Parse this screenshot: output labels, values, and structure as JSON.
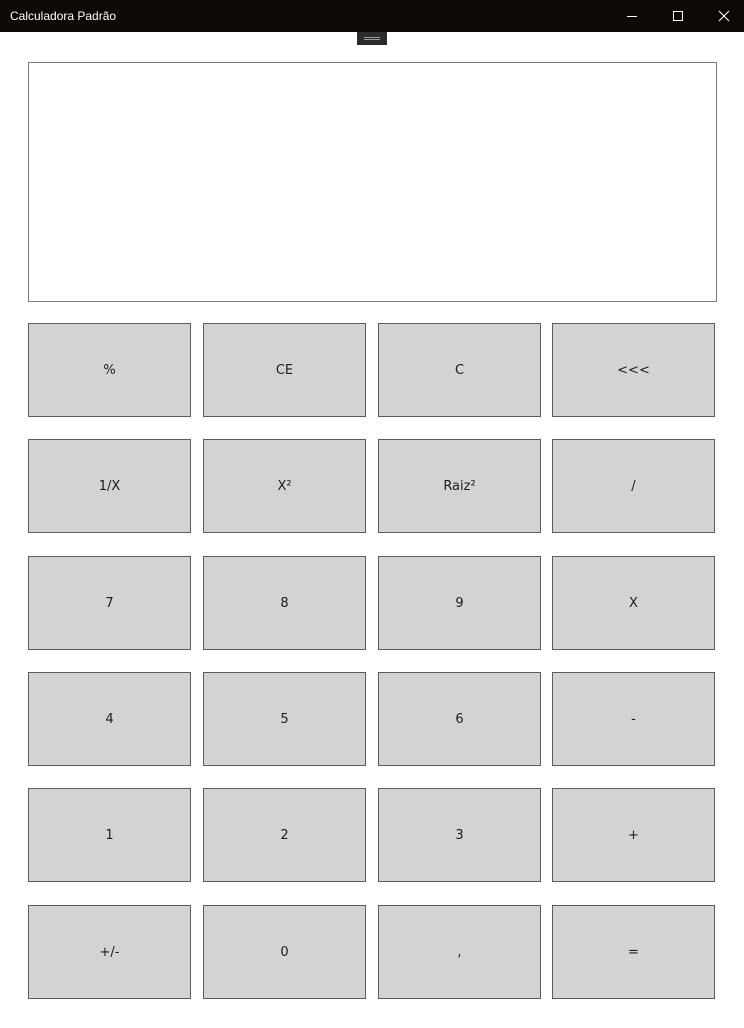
{
  "window": {
    "title": "Calculadora Padrão",
    "controls": {
      "minimize": "minimize-icon",
      "maximize": "maximize-icon",
      "close": "close-icon"
    }
  },
  "display": {
    "value": ""
  },
  "keys": [
    [
      "%",
      "CE",
      "C",
      "<<<"
    ],
    [
      "1/X",
      "X²",
      "Raiz²",
      "/"
    ],
    [
      "7",
      "8",
      "9",
      "X"
    ],
    [
      "4",
      "5",
      "6",
      "-"
    ],
    [
      "1",
      "2",
      "3",
      "+"
    ],
    [
      "+/-",
      "0",
      ",",
      "="
    ]
  ],
  "colors": {
    "titlebar": "#0d0a06",
    "key_background": "#d3d3d3",
    "key_border": "#5c5c5c"
  }
}
